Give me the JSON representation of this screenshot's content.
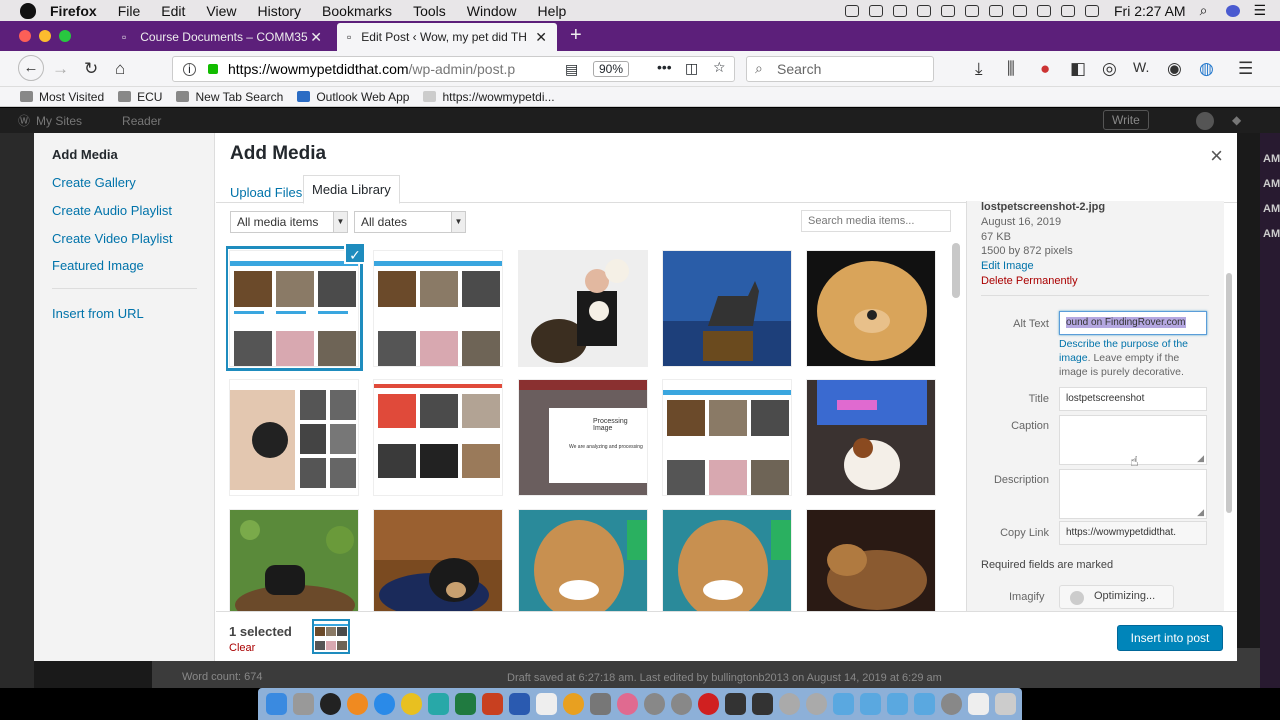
{
  "os_menubar": {
    "app": "Firefox",
    "menus": [
      "File",
      "Edit",
      "View",
      "History",
      "Bookmarks",
      "Tools",
      "Window",
      "Help"
    ],
    "clock": "Fri 2:27 AM"
  },
  "tabs": [
    {
      "label": "Course Documents – COMM35",
      "active": false
    },
    {
      "label": "Edit Post ‹ Wow, my pet did TH",
      "active": true
    }
  ],
  "navbar": {
    "url_host": "https://wowmypetdidthat.com",
    "url_path": "/wp-admin/post.p",
    "zoom": "90%",
    "search_placeholder": "Search"
  },
  "bookmarks": [
    "Most Visited",
    "ECU",
    "New Tab Search",
    "Outlook Web App",
    "https://wowmypetdi..."
  ],
  "wp_adminbar": {
    "my_sites": "My Sites",
    "reader": "Reader",
    "write": "Write"
  },
  "background_page": {
    "word_count": "Word count: 674",
    "draft_status": "Draft saved at 6:27:18 am. Last edited by bullingtonb2013 on August 14, 2019 at 6:29 am",
    "right_edge_text": "AM"
  },
  "media_modal": {
    "sidebar": {
      "heading": "Add Media",
      "links": [
        "Create Gallery",
        "Create Audio Playlist",
        "Create Video Playlist",
        "Featured Image"
      ],
      "insert_from_url": "Insert from URL"
    },
    "title": "Add Media",
    "close": "×",
    "tabs": {
      "upload": "Upload Files",
      "library": "Media Library"
    },
    "filters": {
      "type": "All media items",
      "date": "All dates"
    },
    "search_placeholder": "Search media items...",
    "thumbnails": [
      {
        "name": "lostpet-screenshot-1",
        "selected": true
      },
      {
        "name": "lostpet-screenshot-2",
        "selected": false
      },
      {
        "name": "man-with-dogs",
        "selected": false
      },
      {
        "name": "dog-statue-trophy",
        "selected": false
      },
      {
        "name": "golden-retriever",
        "selected": false
      },
      {
        "name": "dog-nose-matches",
        "selected": false
      },
      {
        "name": "lost-pet-listing",
        "selected": false
      },
      {
        "name": "processing-image",
        "selected": false
      },
      {
        "name": "lostpet-screenshot-3",
        "selected": false
      },
      {
        "name": "dog-watching-tv",
        "selected": false
      },
      {
        "name": "tracker-on-ground",
        "selected": false
      },
      {
        "name": "dog-on-floor",
        "selected": false
      },
      {
        "name": "dog-calendar-1",
        "selected": false
      },
      {
        "name": "dog-calendar-2",
        "selected": false
      },
      {
        "name": "dog-in-dark",
        "selected": false
      }
    ],
    "processing_text": "Processing Image",
    "processing_sub": "We are analyzing and processing",
    "details": {
      "filename": "lostpetscreenshot-2.jpg",
      "date": "August 16, 2019",
      "size": "67 KB",
      "dimensions": "1500 by 872 pixels",
      "edit": "Edit Image",
      "delete": "Delete Permanently",
      "alt_label": "Alt Text",
      "alt_value": "ound on FindingRover.com",
      "help_link": "Describe the purpose of the image",
      "help_rest": ". Leave empty if the image is purely decorative.",
      "title_label": "Title",
      "title_value": "lostpetscreenshot",
      "caption_label": "Caption",
      "description_label": "Description",
      "copy_link_label": "Copy Link",
      "copy_link_value": "https://wowmypetdidthat.",
      "required": "Required fields are marked",
      "imagify_label": "Imagify",
      "optimizing": "Optimizing..."
    },
    "footer": {
      "selected_count": "1 selected",
      "clear": "Clear",
      "insert_button": "Insert into post"
    }
  },
  "colors": {
    "firefox_tabbar": "#5c1f7a",
    "wp_blue": "#0085ba",
    "link_blue": "#0073aa",
    "selected_outline": "#1e8cbe",
    "delete_red": "#a00"
  }
}
